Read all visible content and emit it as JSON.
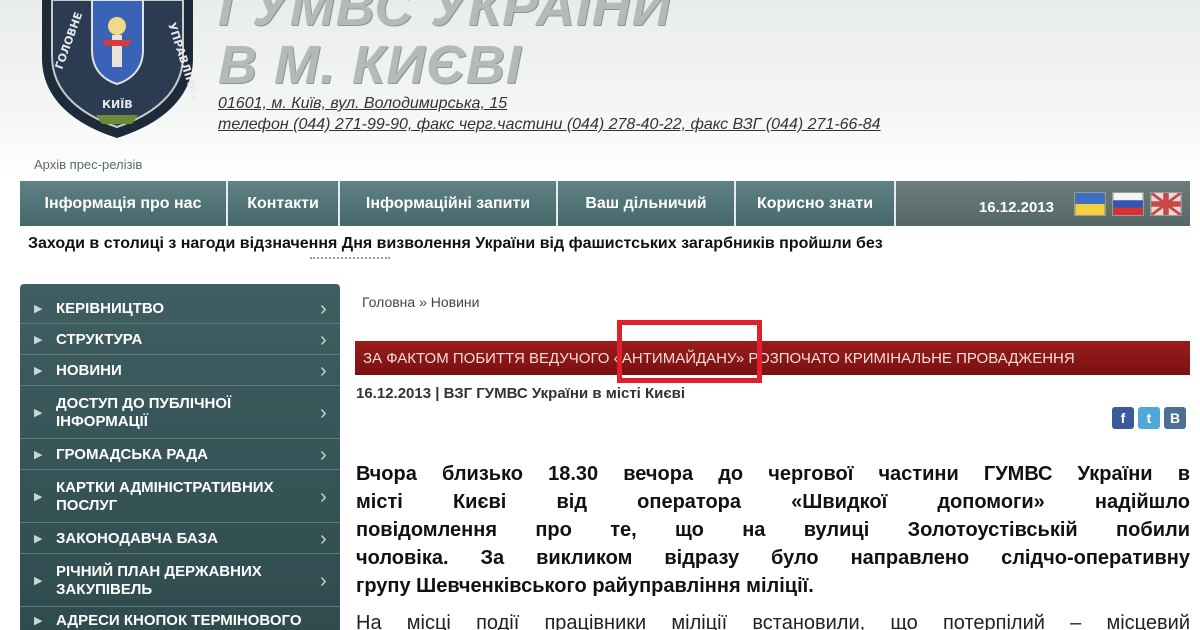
{
  "header": {
    "title_line1": "ГУМВС УКРАЇНИ",
    "title_line2": "В М. КИЄВІ",
    "address_line": "01601, м. Київ, вул. Володимирська, 15",
    "phone_line": "телефон (044) 271-99-90, факс черг.частини (044) 278-40-22, факс ВЗГ (044) 271-66-84",
    "emblem_top_text": "ГОЛОВНЕ",
    "emblem_right_text": "УПРАВЛІННЯ",
    "emblem_bottom_text": "КИЇВ"
  },
  "archive_link": "Архів прес-релізів",
  "nav": {
    "items": [
      {
        "label": "Інформація про нас"
      },
      {
        "label": "Контакти"
      },
      {
        "label": "Інформаційні запити"
      },
      {
        "label": "Ваш дільничий"
      },
      {
        "label": "Корисно знати"
      }
    ],
    "date": "16.12.2013",
    "flags": [
      "ukraine-flag-icon",
      "russia-flag-icon",
      "uk-flag-icon"
    ]
  },
  "ticker": "Заходи в столиці з нагоди відзначення Дня визволення України від фашистських загарбників пройшли без",
  "sidebar": {
    "items": [
      {
        "label": "КЕРІВНИЦТВО"
      },
      {
        "label": "СТРУКТУРА"
      },
      {
        "label": "НОВИНИ"
      },
      {
        "label": "ДОСТУП ДО ПУБЛІЧНОЇ ІНФОРМАЦІЇ"
      },
      {
        "label": "ГРОМАДСЬКА РАДА"
      },
      {
        "label": "КАРТКИ АДМІНІСТРАТИВНИХ ПОСЛУГ"
      },
      {
        "label": "ЗАКОНОДАВЧА БАЗА"
      },
      {
        "label": "РІЧНИЙ ПЛАН ДЕРЖАВНИХ ЗАКУПІВЕЛЬ"
      },
      {
        "label": "АДРЕСИ КНОПОК ТЕРМІНОВОГО"
      }
    ]
  },
  "breadcrumb": "Головна » Новини",
  "article": {
    "headline": "ЗА ФАКТОМ ПОБИТТЯ ВЕДУЧОГО «АНТИМАЙДАНУ» РОЗПОЧАТО КРИМІНАЛЬНЕ ПРОВАДЖЕННЯ",
    "meta": "16.12.2013  |  ВЗГ ГУМВС України в місті Києві",
    "share": {
      "facebook": "f",
      "twitter": "t",
      "vkontakte": "B"
    },
    "lead_lines": [
      "Вчора близько 18.30  вечора до чергової частини ГУМВС України в",
      "місті Києві від оператора «Швидкої допомоги» надійшло",
      "повідомлення про те, що на вулиці Золотоустівській побили",
      "чоловіка. За викликом відразу було направлено слідчо-оперативну",
      "групу Шевченківського райуправління міліції."
    ],
    "body_start": "На місці події працівники міліції встановили, що потерпілий – місцевий"
  },
  "colors": {
    "nav_bg": "#4f6f72",
    "sidebar_bg": "#3f5e61",
    "headline_bg": "#8a1616",
    "highlight": "#e0202a"
  }
}
